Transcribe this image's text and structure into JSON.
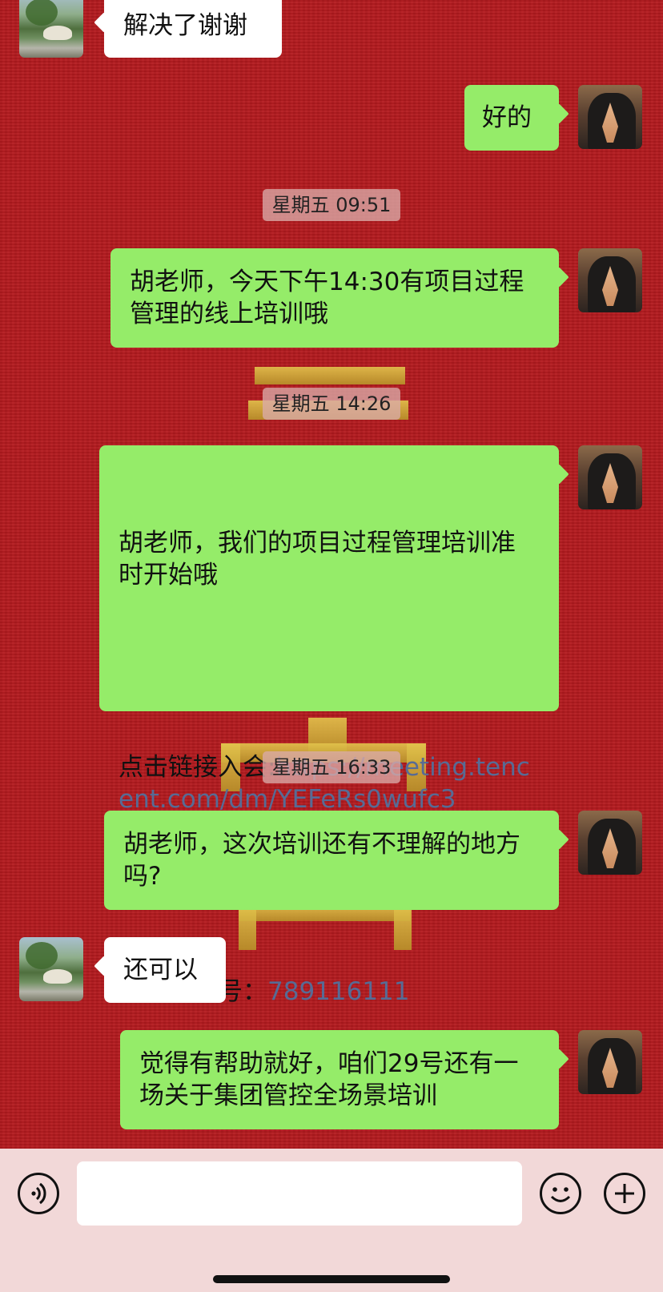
{
  "colors": {
    "background": "#b41a1e",
    "bubble_self": "#95ec69",
    "bubble_other": "#ffffff",
    "link": "#576b95",
    "input_bar": "#f2d8d8"
  },
  "messages": [
    {
      "side": "left",
      "text": "解决了谢谢"
    },
    {
      "side": "right",
      "text": "好的"
    },
    {
      "timestamp": "星期五 09:51"
    },
    {
      "side": "right",
      "text": "胡老师，今天下午14:30有项目过程管理的线上培训哦"
    },
    {
      "timestamp": "星期五 14:26"
    },
    {
      "side": "right",
      "intro": "胡老师，我们的项目过程管理培训准时开始哦",
      "join_label": "点击链接入会:",
      "join_link": "https://meeting.tencent.com/dm/YEFeRs0wufc3",
      "meeting_label": "腾讯会议号：",
      "meeting_number": "789116111"
    },
    {
      "timestamp": "星期五 16:33"
    },
    {
      "side": "right",
      "text": "胡老师，这次培训还有不理解的地方吗?"
    },
    {
      "side": "left",
      "text": "还可以"
    },
    {
      "side": "right",
      "text": "觉得有帮助就好，咱们29号还有一场关于集团管控全场景培训"
    }
  ],
  "input_bar": {
    "voice_icon": "voice-icon",
    "emoji_icon": "emoji-icon",
    "plus_icon": "plus-icon",
    "text_value": ""
  }
}
